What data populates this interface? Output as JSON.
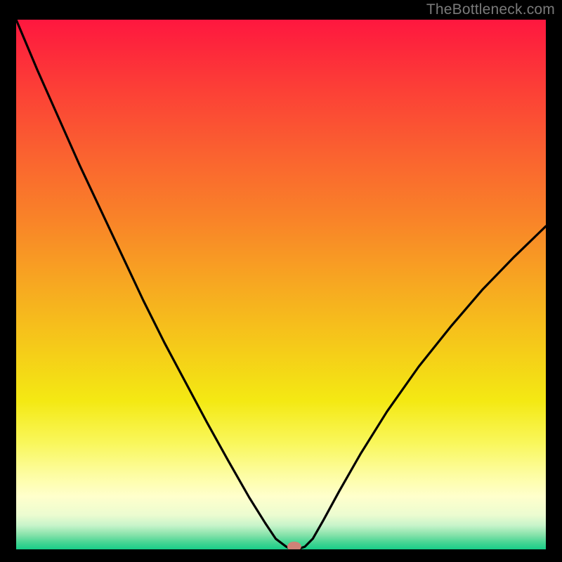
{
  "watermark": "TheBottleneck.com",
  "chart_data": {
    "type": "line",
    "title": "",
    "xlabel": "",
    "ylabel": "",
    "xlim": [
      0,
      1
    ],
    "ylim": [
      0,
      1
    ],
    "background_gradient": {
      "stops": [
        {
          "offset": 0.0,
          "color": "#fe173f"
        },
        {
          "offset": 0.12,
          "color": "#fc3c37"
        },
        {
          "offset": 0.25,
          "color": "#fa6130"
        },
        {
          "offset": 0.38,
          "color": "#f98428"
        },
        {
          "offset": 0.5,
          "color": "#f7a821"
        },
        {
          "offset": 0.62,
          "color": "#f5cb19"
        },
        {
          "offset": 0.72,
          "color": "#f4e913"
        },
        {
          "offset": 0.8,
          "color": "#f9f75c"
        },
        {
          "offset": 0.86,
          "color": "#fdfda3"
        },
        {
          "offset": 0.9,
          "color": "#ffffcc"
        },
        {
          "offset": 0.935,
          "color": "#ecfcd0"
        },
        {
          "offset": 0.955,
          "color": "#c7f4ca"
        },
        {
          "offset": 0.972,
          "color": "#89e3ab"
        },
        {
          "offset": 0.986,
          "color": "#4bd695"
        },
        {
          "offset": 1.0,
          "color": "#18cd88"
        }
      ]
    },
    "series": [
      {
        "name": "bottleneck-curve",
        "x": [
          0.0,
          0.04,
          0.08,
          0.12,
          0.16,
          0.2,
          0.24,
          0.28,
          0.32,
          0.36,
          0.4,
          0.44,
          0.47,
          0.49,
          0.51,
          0.52,
          0.53,
          0.545,
          0.56,
          0.58,
          0.61,
          0.65,
          0.7,
          0.76,
          0.82,
          0.88,
          0.94,
          1.0
        ],
        "y": [
          1.0,
          0.905,
          0.815,
          0.725,
          0.64,
          0.555,
          0.47,
          0.39,
          0.315,
          0.24,
          0.168,
          0.098,
          0.05,
          0.02,
          0.005,
          0.0,
          0.0,
          0.005,
          0.02,
          0.055,
          0.11,
          0.18,
          0.26,
          0.345,
          0.42,
          0.49,
          0.552,
          0.61
        ]
      }
    ],
    "marker": {
      "name": "minimum-point",
      "x": 0.525,
      "y": 0.0,
      "color": "#cf8277",
      "rx": 10,
      "ry": 7
    }
  }
}
